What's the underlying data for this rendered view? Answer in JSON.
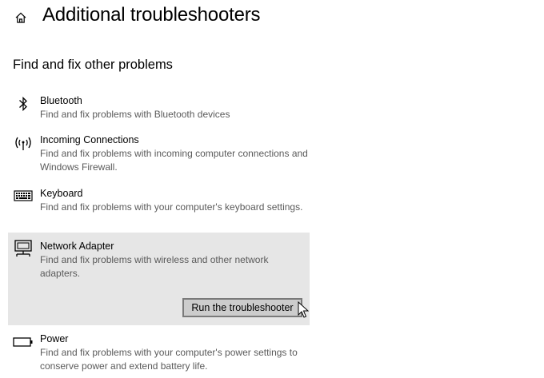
{
  "header": {
    "home_icon": "home-icon",
    "title": "Additional troubleshooters"
  },
  "section": {
    "title": "Find and fix other problems"
  },
  "items": [
    {
      "icon": "bluetooth-icon",
      "name": "Bluetooth",
      "description": "Find and fix problems with Bluetooth devices"
    },
    {
      "icon": "antenna-icon",
      "name": "Incoming Connections",
      "description": "Find and fix problems with incoming computer connections and Windows Firewall."
    },
    {
      "icon": "keyboard-icon",
      "name": "Keyboard",
      "description": "Find and fix problems with your computer's keyboard settings."
    },
    {
      "icon": "network-adapter-icon",
      "name": "Network Adapter",
      "description": "Find and fix problems with wireless and other network adapters.",
      "selected": true,
      "button_label": "Run the troubleshooter"
    },
    {
      "icon": "battery-icon",
      "name": "Power",
      "description": "Find and fix problems with your computer's power settings to conserve power and extend battery life."
    }
  ],
  "colors": {
    "selected_background": "#e6e6e6",
    "button_background": "#cccccc",
    "button_border": "#7a7a7a",
    "description_text": "#5a5a5a"
  }
}
